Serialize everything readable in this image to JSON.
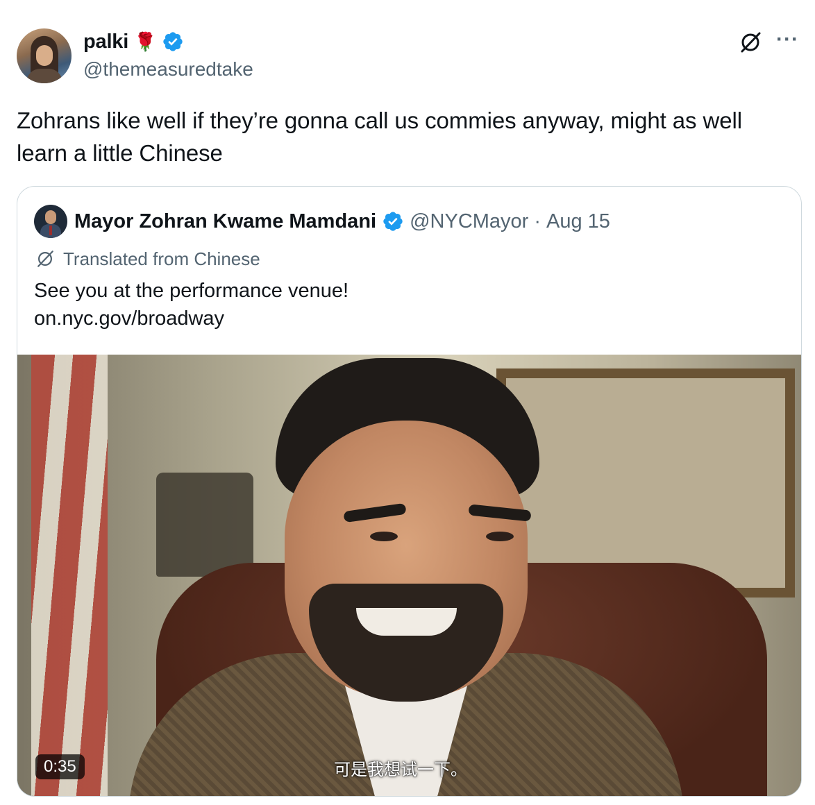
{
  "post": {
    "author": {
      "name": "palki",
      "emoji": "🌹",
      "handle": "@themeasuredtake",
      "verified": true
    },
    "text": "Zohrans like well if they’re gonna call us commies anyway, might as well learn a little Chinese",
    "more_label": "···"
  },
  "quote": {
    "author": {
      "name": "Mayor Zohran Kwame Mamdani",
      "handle": "@NYCMayor",
      "verified": true
    },
    "separator": "·",
    "date": "Aug 15",
    "translated_label": "Translated from Chinese",
    "text_line1": "See you at the performance venue!",
    "text_line2": "on.nyc.gov/broadway",
    "video": {
      "duration": "0:35",
      "subtitle": "可是我想试一下。"
    }
  },
  "colors": {
    "verified_blue": "#1d9bf0",
    "secondary_text": "#536471",
    "border": "#cfd9de"
  }
}
